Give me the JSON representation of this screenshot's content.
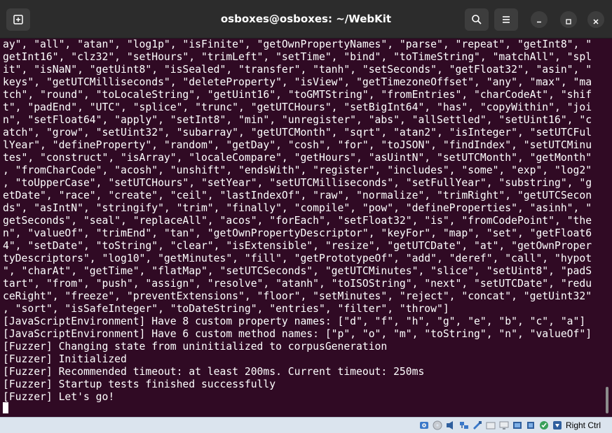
{
  "window": {
    "title": "osboxes@osboxes: ~/WebKit"
  },
  "terminal": {
    "lines": [
      "ay\", \"all\", \"atan\", \"log1p\", \"isFinite\", \"getOwnPropertyNames\", \"parse\", \"repeat\", \"getInt8\", \"",
      "getInt16\", \"clz32\", \"setHours\", \"trimLeft\", \"setTime\", \"bind\", \"toTimeString\", \"matchAll\", \"spl",
      "it\", \"isNaN\", \"getUint8\", \"isSealed\", \"transfer\", \"tanh\", \"setSeconds\", \"getFloat32\", \"asin\", \"",
      "keys\", \"getUTCMilliseconds\", \"deleteProperty\", \"isView\", \"getTimezoneOffset\", \"any\", \"max\", \"ma",
      "tch\", \"round\", \"toLocaleString\", \"getUint16\", \"toGMTString\", \"fromEntries\", \"charCodeAt\", \"shif",
      "t\", \"padEnd\", \"UTC\", \"splice\", \"trunc\", \"getUTCHours\", \"setBigInt64\", \"has\", \"copyWithin\", \"joi",
      "n\", \"setFloat64\", \"apply\", \"setInt8\", \"min\", \"unregister\", \"abs\", \"allSettled\", \"setUint16\", \"c",
      "atch\", \"grow\", \"setUint32\", \"subarray\", \"getUTCMonth\", \"sqrt\", \"atan2\", \"isInteger\", \"setUTCFul",
      "lYear\", \"defineProperty\", \"random\", \"getDay\", \"cosh\", \"for\", \"toJSON\", \"findIndex\", \"setUTCMinu",
      "tes\", \"construct\", \"isArray\", \"localeCompare\", \"getHours\", \"asUintN\", \"setUTCMonth\", \"getMonth\"",
      ", \"fromCharCode\", \"acosh\", \"unshift\", \"endsWith\", \"register\", \"includes\", \"some\", \"exp\", \"log2\"",
      ", \"toUpperCase\", \"setUTCHours\", \"setYear\", \"setUTCMilliseconds\", \"setFullYear\", \"substring\", \"g",
      "etDate\", \"race\", \"create\", \"ceil\", \"lastIndexOf\", \"raw\", \"normalize\", \"trimRight\", \"getUTCSecon",
      "ds\", \"asIntN\", \"stringify\", \"trim\", \"finally\", \"compile\", \"pow\", \"defineProperties\", \"asinh\", \"",
      "getSeconds\", \"seal\", \"replaceAll\", \"acos\", \"forEach\", \"setFloat32\", \"is\", \"fromCodePoint\", \"the",
      "n\", \"valueOf\", \"trimEnd\", \"tan\", \"getOwnPropertyDescriptor\", \"keyFor\", \"map\", \"set\", \"getFloat6",
      "4\", \"setDate\", \"toString\", \"clear\", \"isExtensible\", \"resize\", \"getUTCDate\", \"at\", \"getOwnProper",
      "tyDescriptors\", \"log10\", \"getMinutes\", \"fill\", \"getPrototypeOf\", \"add\", \"deref\", \"call\", \"hypot",
      "\", \"charAt\", \"getTime\", \"flatMap\", \"setUTCSeconds\", \"getUTCMinutes\", \"slice\", \"setUint8\", \"padS",
      "tart\", \"from\", \"push\", \"assign\", \"resolve\", \"atanh\", \"toISOString\", \"next\", \"setUTCDate\", \"redu",
      "ceRight\", \"freeze\", \"preventExtensions\", \"floor\", \"setMinutes\", \"reject\", \"concat\", \"getUint32\"",
      ", \"sort\", \"isSafeInteger\", \"toDateString\", \"entries\", \"filter\", \"throw\"]",
      "[JavaScriptEnvironment] Have 8 custom property names: [\"d\", \"f\", \"h\", \"g\", \"e\", \"b\", \"c\", \"a\"]",
      "[JavaScriptEnvironment] Have 6 custom method names: [\"p\", \"o\", \"m\", \"toString\", \"n\", \"valueOf\"]",
      "[Fuzzer] Changing state from uninitialized to corpusGeneration",
      "[Fuzzer] Initialized",
      "[Fuzzer] Recommended timeout: at least 200ms. Current timeout: 250ms",
      "[Fuzzer] Startup tests finished successfully",
      "[Fuzzer] Let's go!"
    ]
  },
  "statusbar": {
    "host_key": "Right Ctrl"
  },
  "icons": {
    "new_tab": "new-tab-icon",
    "search": "search-icon",
    "menu": "hamburger-menu-icon",
    "minimize": "minimize-icon",
    "maximize": "maximize-icon",
    "close": "close-icon"
  },
  "colors": {
    "terminal_bg": "#300a24",
    "titlebar_bg": "#2c2c2c",
    "text": "#ffffff",
    "statusbar_bg": "#dbe4ee"
  }
}
